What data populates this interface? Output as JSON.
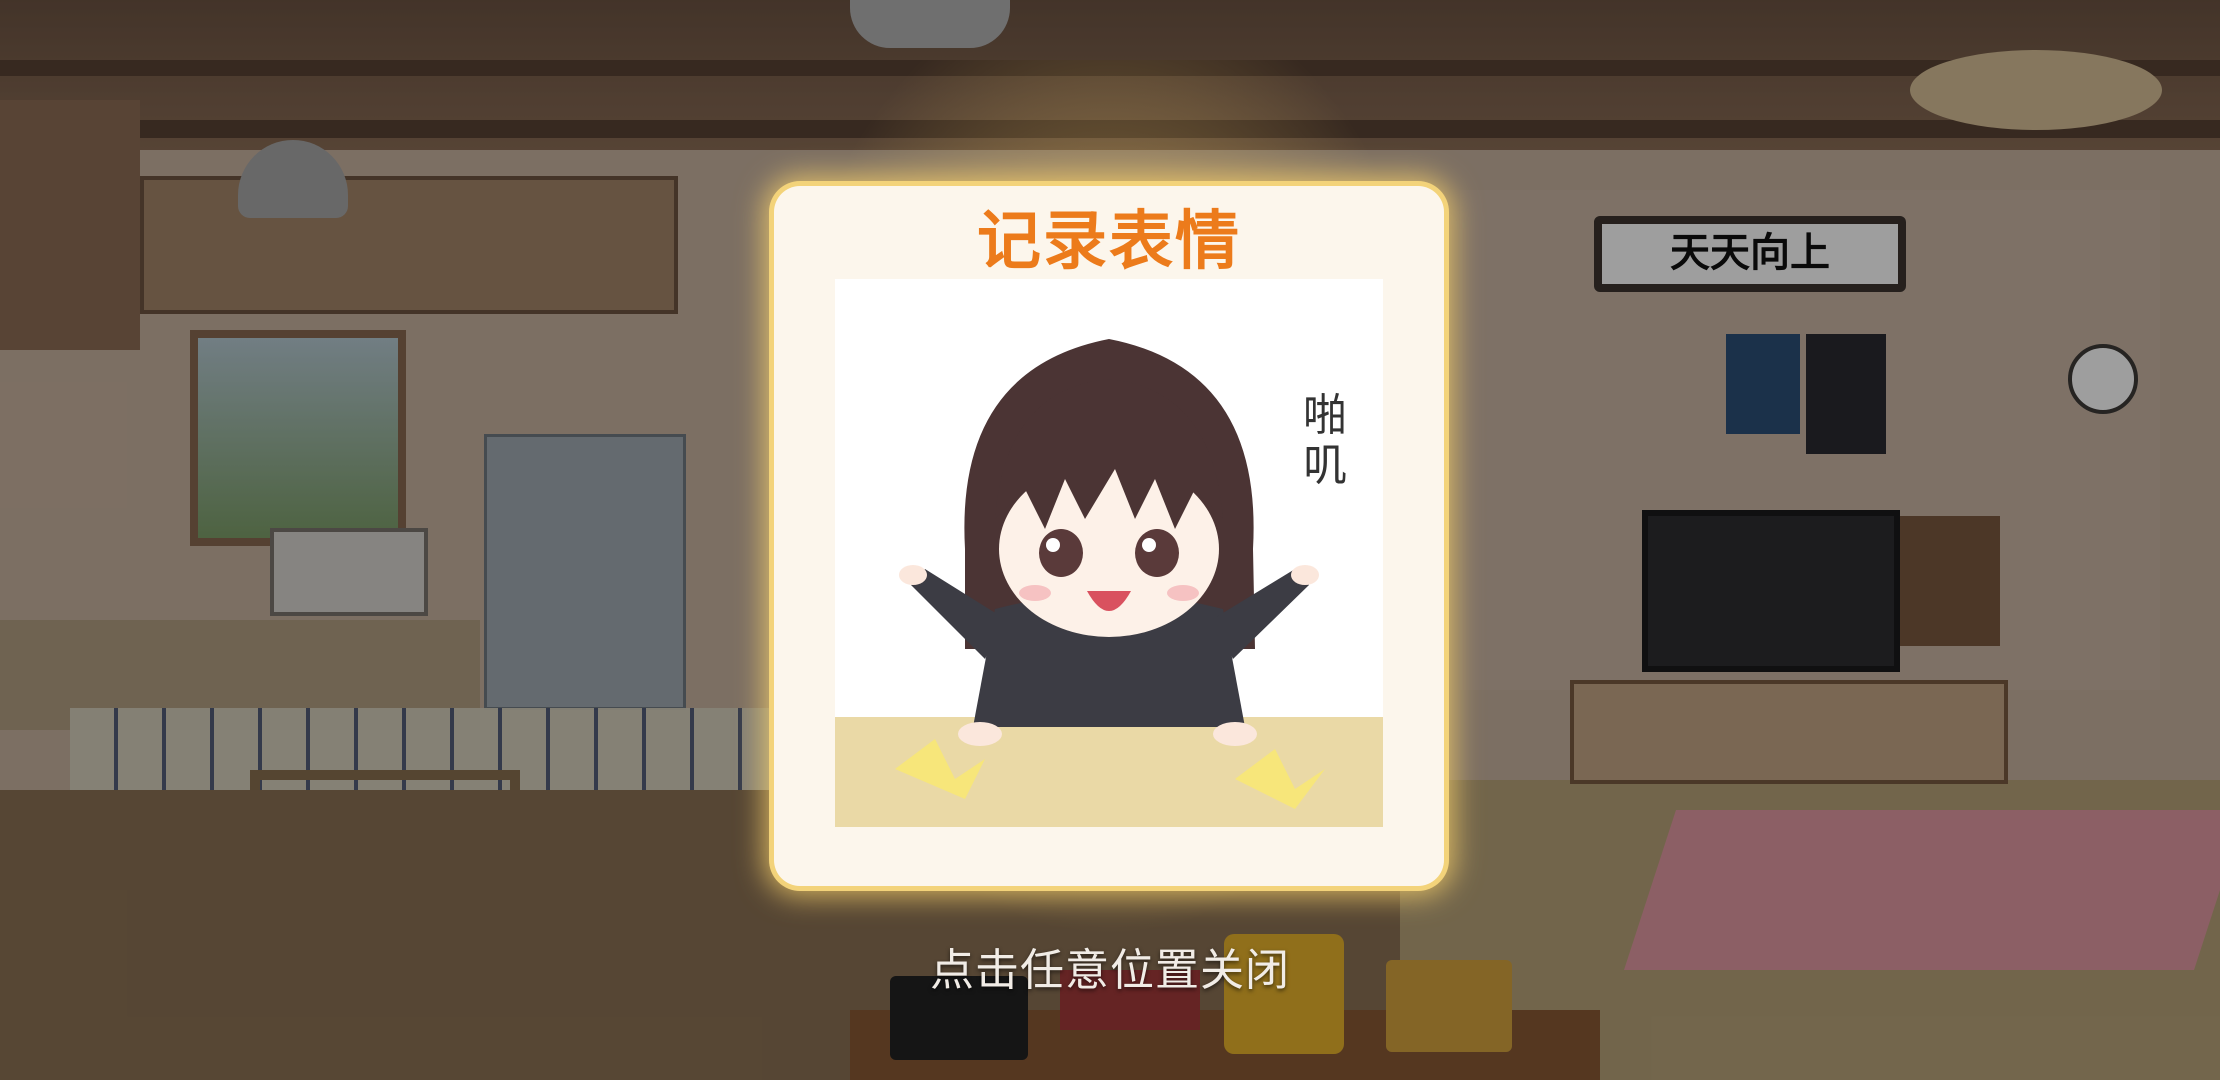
{
  "dialog": {
    "title": "记录表情",
    "sticker_caption": "啪叽"
  },
  "background": {
    "wall_sign_text": "天天向上"
  },
  "hint": {
    "close_text": "点击任意位置关闭"
  },
  "colors": {
    "title_orange": "#ec7b1b",
    "dialog_bg": "#fcf6ec",
    "glow": "#f3d37a",
    "hint_text": "#f1ece6"
  }
}
